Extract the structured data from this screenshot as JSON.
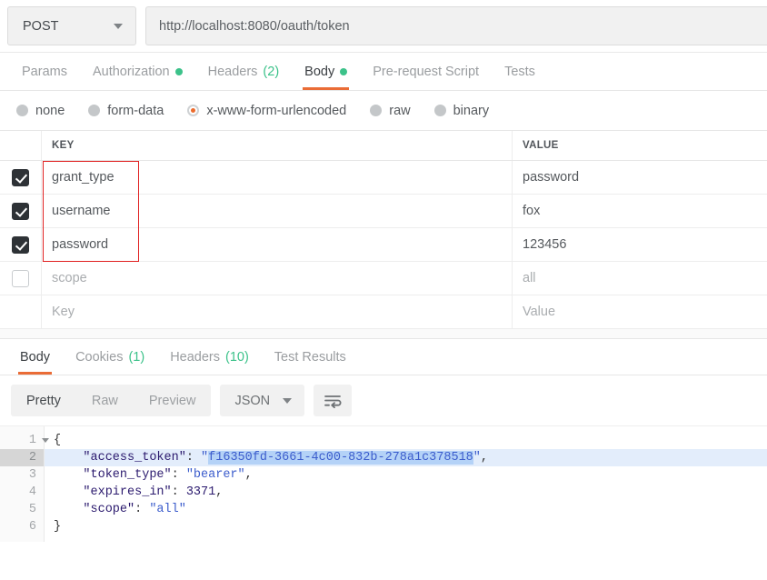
{
  "request": {
    "method": "POST",
    "url": "http://localhost:8080/oauth/token",
    "tabs": [
      {
        "label": "Params",
        "active": false,
        "dot": false,
        "count": ""
      },
      {
        "label": "Authorization",
        "active": false,
        "dot": true,
        "count": ""
      },
      {
        "label": "Headers",
        "active": false,
        "dot": false,
        "count": "(2)"
      },
      {
        "label": "Body",
        "active": true,
        "dot": true,
        "count": ""
      },
      {
        "label": "Pre-request Script",
        "active": false,
        "dot": false,
        "count": ""
      },
      {
        "label": "Tests",
        "active": false,
        "dot": false,
        "count": ""
      }
    ],
    "body_types": [
      {
        "label": "none",
        "selected": false
      },
      {
        "label": "form-data",
        "selected": false
      },
      {
        "label": "x-www-form-urlencoded",
        "selected": true
      },
      {
        "label": "raw",
        "selected": false
      },
      {
        "label": "binary",
        "selected": false
      }
    ],
    "table": {
      "headers": {
        "key": "KEY",
        "value": "VALUE"
      },
      "rows": [
        {
          "checked": true,
          "key": "grant_type",
          "value": "password",
          "placeholder": false
        },
        {
          "checked": true,
          "key": "username",
          "value": "fox",
          "placeholder": false
        },
        {
          "checked": true,
          "key": "password",
          "value": "123456",
          "placeholder": false
        },
        {
          "checked": false,
          "key": "scope",
          "value": "all",
          "placeholder": true
        },
        {
          "checked": null,
          "key": "Key",
          "value": "Value",
          "placeholder": true
        }
      ]
    }
  },
  "response": {
    "tabs": [
      {
        "label": "Body",
        "active": true,
        "count": ""
      },
      {
        "label": "Cookies",
        "active": false,
        "count": "(1)"
      },
      {
        "label": "Headers",
        "active": false,
        "count": "(10)"
      },
      {
        "label": "Test Results",
        "active": false,
        "count": ""
      }
    ],
    "view_modes": [
      {
        "label": "Pretty",
        "active": true
      },
      {
        "label": "Raw",
        "active": false
      },
      {
        "label": "Preview",
        "active": false
      }
    ],
    "format": "JSON",
    "code": {
      "line_numbers": [
        "1",
        "2",
        "3",
        "4",
        "5",
        "6"
      ],
      "active_line": 2,
      "body": {
        "open_brace": "{",
        "access_token_key": "\"access_token\"",
        "access_token_value": "f16350fd-3661-4c00-832b-278a1c378518",
        "token_type_key": "\"token_type\"",
        "token_type_value": "\"bearer\"",
        "expires_in_key": "\"expires_in\"",
        "expires_in_value": "3371",
        "scope_key": "\"scope\"",
        "scope_value": "\"all\"",
        "close_brace": "}"
      }
    }
  },
  "colors": {
    "accent_orange": "#ea6c36",
    "dot_green": "#3cc28a",
    "annotation_red": "#e02020",
    "selection_blue": "#b4d2f7"
  }
}
